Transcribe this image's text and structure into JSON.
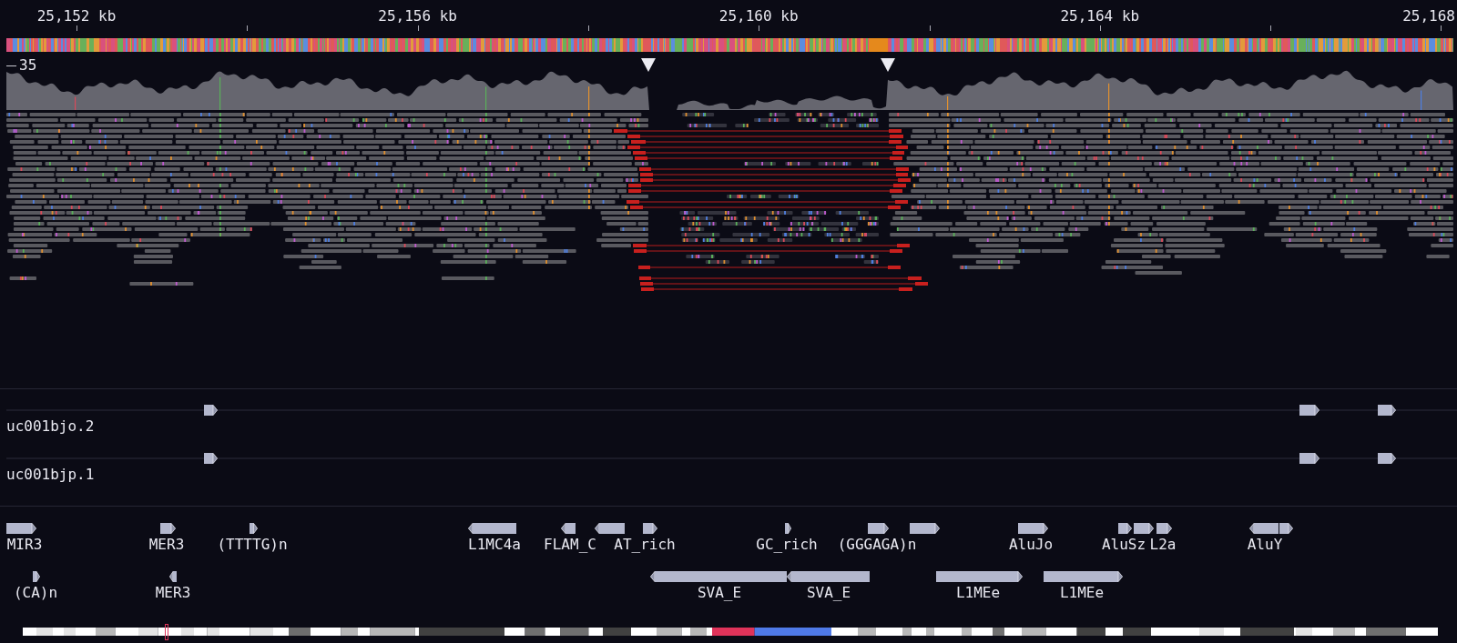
{
  "ruler": {
    "labels": [
      "25,152 kb",
      "25,156 kb",
      "25,160 kb",
      "25,164 kb",
      "25,168"
    ]
  },
  "coverage": {
    "scale_label": "35"
  },
  "gene_track": {
    "transcripts": [
      {
        "name": "uc001bjo.2",
        "reverse": false
      },
      {
        "name": "uc001bjp.1",
        "reverse": false
      }
    ]
  },
  "repeat_track": {
    "rows": [
      [
        {
          "name": "MIR3",
          "reverse": false
        },
        {
          "name": "MER3",
          "reverse": false
        },
        {
          "name": "(TTTTG)n",
          "reverse": false
        },
        {
          "name": "L1MC4a",
          "reverse": true
        },
        {
          "name": "FLAM_C",
          "reverse": true
        },
        {
          "reverse": true
        },
        {
          "name": "AT_rich",
          "reverse": false
        },
        {
          "name": "GC_rich",
          "reverse": false
        },
        {
          "name": "(GGGAGA)n",
          "reverse": false
        },
        {
          "reverse": false
        },
        {
          "name": "AluJo",
          "reverse": false
        },
        {
          "name": "AluSz",
          "reverse": false
        },
        {
          "reverse": false
        },
        {
          "name": "L2a",
          "reverse": false
        },
        {
          "name": "AluY",
          "reverse": true
        },
        {
          "reverse": false
        }
      ],
      [
        {
          "name": "(CA)n",
          "reverse": false
        },
        {
          "name": "MER3",
          "reverse": true
        },
        {
          "name": "SVA_E",
          "reverse": true
        },
        {
          "name": "SVA_E",
          "reverse": true
        },
        {
          "name": "L1MEe",
          "reverse": false
        },
        {
          "name": "L1MEe",
          "reverse": false
        }
      ]
    ]
  }
}
